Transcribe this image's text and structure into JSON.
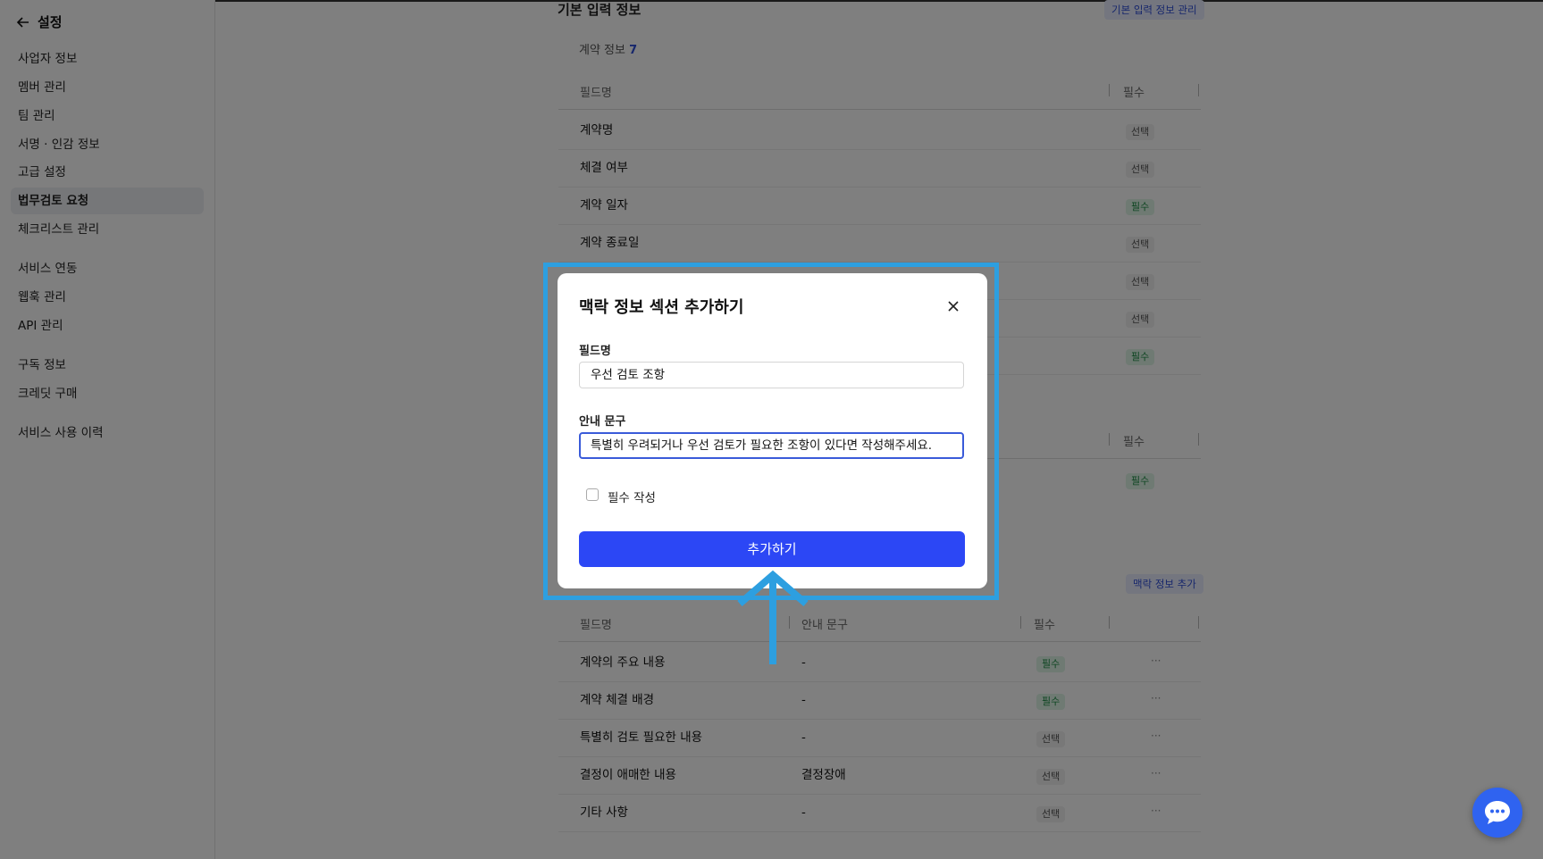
{
  "sidebar": {
    "back_label": "설정",
    "items": [
      {
        "label": "사업자 정보"
      },
      {
        "label": "멤버 관리"
      },
      {
        "label": "팀 관리"
      },
      {
        "label": "서명 · 인감 정보"
      },
      {
        "label": "고급 설정"
      },
      {
        "label": "법무검토 요청",
        "active": true
      },
      {
        "label": "체크리스트 관리"
      },
      {
        "label": "서비스 연동"
      },
      {
        "label": "웹훅 관리"
      },
      {
        "label": "API 관리"
      },
      {
        "label": "구독 정보"
      },
      {
        "label": "크레딧 구매"
      },
      {
        "label": "서비스 사용 이력"
      }
    ]
  },
  "main": {
    "section_title": "기본 입력 정보",
    "manage_button": "기본 입력 정보 관리",
    "contract_info_label": "계약 정보",
    "contract_info_count": "7",
    "col_field": "필드명",
    "col_required": "필수",
    "contract_rows": [
      {
        "name": "계약명",
        "badge": "선택"
      },
      {
        "name": "체결 여부",
        "badge": "선택"
      },
      {
        "name": "계약 일자",
        "badge": "필수"
      },
      {
        "name": "계약 종료일",
        "badge": "선택"
      },
      {
        "name": "",
        "badge": "선택"
      },
      {
        "name": "",
        "badge": "선택"
      },
      {
        "name": "",
        "badge": "필수"
      }
    ],
    "second_col_required": "필수",
    "second_row_badge": "필수",
    "context_add_button": "맥락 정보 추가",
    "context_cols": {
      "field": "필드명",
      "guide": "안내 문구",
      "required": "필수"
    },
    "context_rows": [
      {
        "name": "계약의 주요 내용",
        "guide": "-",
        "badge": "필수"
      },
      {
        "name": "계약 체결 배경",
        "guide": "-",
        "badge": "필수"
      },
      {
        "name": "특별히 검토 필요한 내용",
        "guide": "-",
        "badge": "선택"
      },
      {
        "name": "결정이 애매한 내용",
        "guide": "결정장애",
        "badge": "선택"
      },
      {
        "name": "기타 사항",
        "guide": "-",
        "badge": "선택"
      }
    ],
    "more_glyph": "···"
  },
  "modal": {
    "title": "맥락 정보 섹션 추가하기",
    "field_label": "필드명",
    "field_value": "우선 검토 조항",
    "guide_label": "안내 문구",
    "guide_value": "특별히 우려되거나 우선 검토가 필요한 조항이 있다면 작성해주세요.",
    "required_label": "필수 작성",
    "required_checked": false,
    "submit_label": "추가하기"
  },
  "colors": {
    "accent": "#2c47f5",
    "highlight": "#2d9fe0",
    "required_badge": "#1a8a42"
  },
  "icons": [
    "back-arrow-icon",
    "close-icon",
    "checkbox-icon",
    "up-arrow-icon",
    "chat-icon",
    "more-icon"
  ]
}
